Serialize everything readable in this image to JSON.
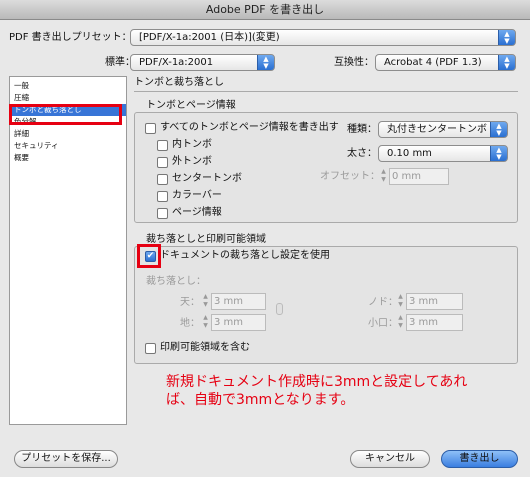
{
  "window": {
    "title": "Adobe PDF を書き出し"
  },
  "preset": {
    "label": "PDF 書き出しプリセット：",
    "value": "[PDF/X-1a:2001 (日本)](変更)"
  },
  "standard": {
    "label": "標準：",
    "value": "PDF/X-1a:2001"
  },
  "compat": {
    "label": "互換性：",
    "value": "Acrobat 4 (PDF 1.3)"
  },
  "sidebar": {
    "items": [
      {
        "label": "一般"
      },
      {
        "label": "圧縮"
      },
      {
        "label": "トンボと裁ち落とし"
      },
      {
        "label": "色分解"
      },
      {
        "label": "詳細"
      },
      {
        "label": "セキュリティ"
      },
      {
        "label": "概要"
      }
    ]
  },
  "section": {
    "title": "トンボと裁ち落とし"
  },
  "marks": {
    "group_title": "トンボとページ情報",
    "all_label": "すべてのトンボとページ情報を書き出す",
    "crop_label": "内トンボ",
    "bleed_label": "外トンボ",
    "reg_label": "センタートンボ",
    "color_label": "カラーバー",
    "page_label": "ページ情報",
    "type_label": "種類：",
    "type_value": "丸付きセンタートンボ",
    "weight_label": "太さ：",
    "weight_value": "0.10 mm",
    "offset_label": "オフセット：",
    "offset_value": "0 mm"
  },
  "bleed": {
    "group_title": "裁ち落としと印刷可能領域",
    "use_doc_label": "ドキュメントの裁ち落とし設定を使用",
    "sub_label": "裁ち落とし：",
    "top_label": "天：",
    "top_value": "3 mm",
    "bottom_label": "地：",
    "bottom_value": "3 mm",
    "inside_label": "ノド：",
    "inside_value": "3 mm",
    "outside_label": "小口：",
    "outside_value": "3 mm",
    "slug_label": "印刷可能領域を含む"
  },
  "note": {
    "line1": "新規ドキュメント作成時に3mmと設定してあれ",
    "line2": "ば、自動で3mmとなります。"
  },
  "buttons": {
    "save_preset": "プリセットを保存...",
    "cancel": "キャンセル",
    "export": "書き出し"
  },
  "colors": {
    "accent": "#3875d7",
    "annotation": "#e60012"
  }
}
